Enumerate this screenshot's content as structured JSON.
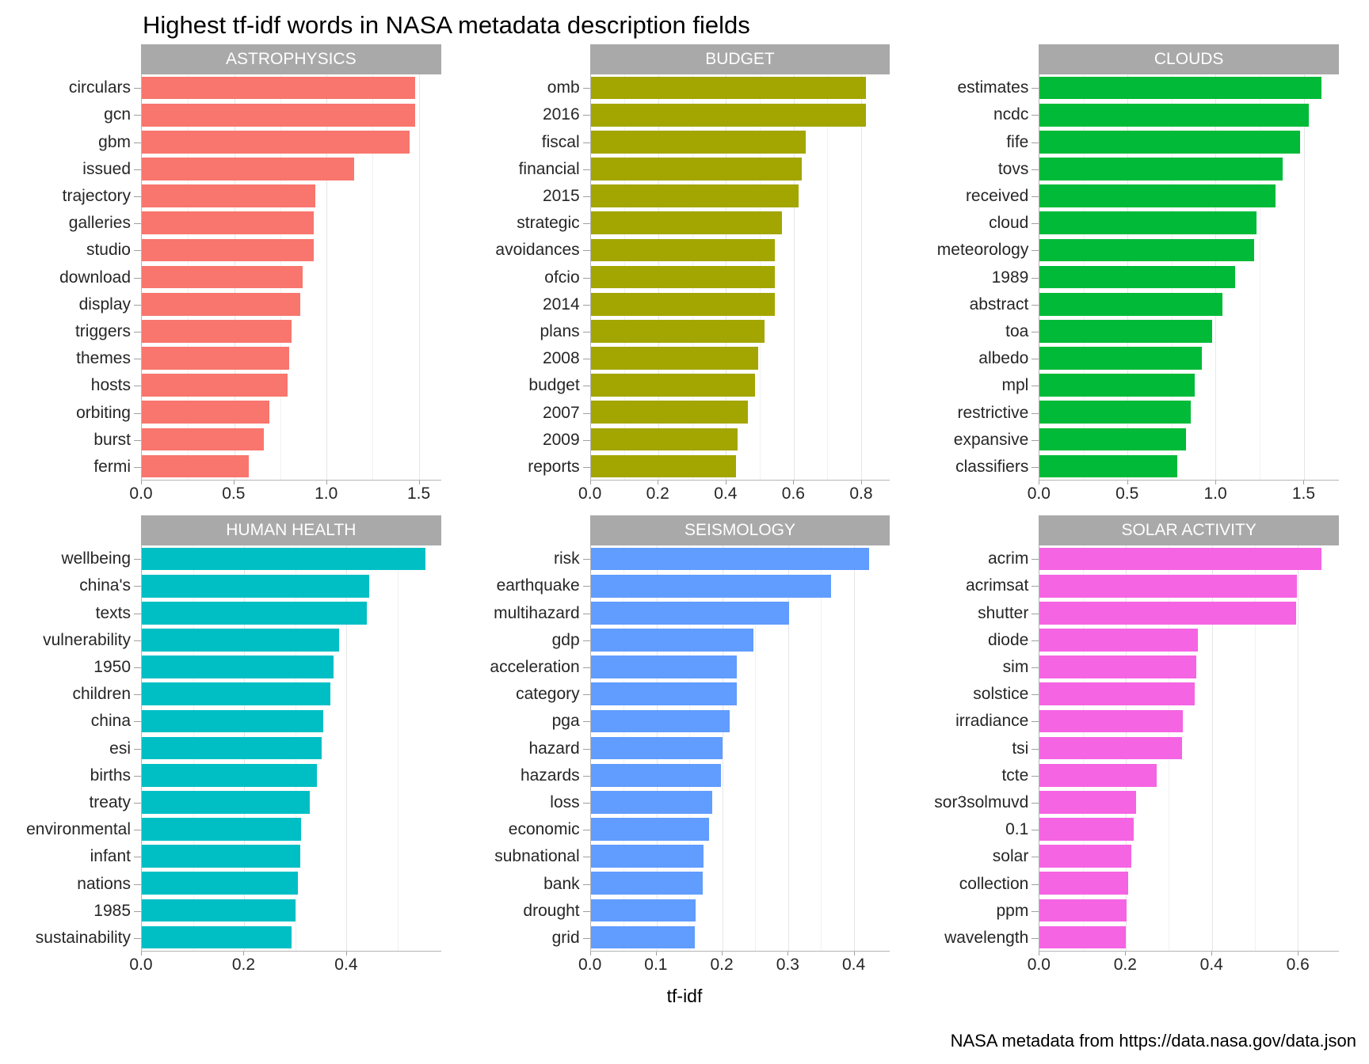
{
  "title": "Highest tf-idf words in NASA metadata description fields",
  "xaxis_title": "tf-idf",
  "caption": "NASA metadata from https://data.nasa.gov/data.json",
  "chart_data": {
    "type": "bar",
    "orientation": "horizontal",
    "title": "Highest tf-idf words in NASA metadata description fields",
    "xlabel": "tf-idf",
    "ylabel": "",
    "caption": "NASA metadata from https://data.nasa.gov/data.json",
    "grid": true,
    "legend": "none",
    "facets": [
      {
        "name": "ASTROPHYSICS",
        "color": "#f8766d",
        "xlim": [
          0,
          1.62
        ],
        "ticks": [
          0.0,
          0.5,
          1.0,
          1.5
        ],
        "tick_labels": [
          "0.0",
          "0.5",
          "1.0",
          "1.5"
        ],
        "minor_ticks": [
          0.25,
          0.75,
          1.25
        ],
        "categories": [
          "circulars",
          "gcn",
          "gbm",
          "issued",
          "trajectory",
          "galleries",
          "studio",
          "download",
          "display",
          "triggers",
          "themes",
          "hosts",
          "orbiting",
          "burst",
          "fermi"
        ],
        "values": [
          1.48,
          1.48,
          1.45,
          1.15,
          0.94,
          0.93,
          0.93,
          0.87,
          0.86,
          0.81,
          0.8,
          0.79,
          0.69,
          0.66,
          0.58
        ]
      },
      {
        "name": "BUDGET",
        "color": "#a3a500",
        "xlim": [
          0,
          0.885
        ],
        "ticks": [
          0.0,
          0.2,
          0.4,
          0.6,
          0.8
        ],
        "tick_labels": [
          "0.0",
          "0.2",
          "0.4",
          "0.6",
          "0.8"
        ],
        "minor_ticks": [
          0.1,
          0.3,
          0.5,
          0.7
        ],
        "categories": [
          "omb",
          "2016",
          "fiscal",
          "financial",
          "2015",
          "strategic",
          "avoidances",
          "ofcio",
          "2014",
          "plans",
          "2008",
          "budget",
          "2007",
          "2009",
          "reports"
        ],
        "values": [
          0.815,
          0.815,
          0.635,
          0.625,
          0.615,
          0.565,
          0.545,
          0.545,
          0.545,
          0.515,
          0.495,
          0.485,
          0.465,
          0.435,
          0.43
        ]
      },
      {
        "name": "CLOUDS",
        "color": "#00ba38",
        "xlim": [
          0,
          1.7
        ],
        "ticks": [
          0.0,
          0.5,
          1.0,
          1.5
        ],
        "tick_labels": [
          "0.0",
          "0.5",
          "1.0",
          "1.5"
        ],
        "minor_ticks": [
          0.25,
          0.75,
          1.25
        ],
        "categories": [
          "estimates",
          "ncdc",
          "fife",
          "tovs",
          "received",
          "cloud",
          "meteorology",
          "1989",
          "abstract",
          "toa",
          "albedo",
          "mpl",
          "restrictive",
          "expansive",
          "classifiers"
        ],
        "values": [
          1.6,
          1.53,
          1.48,
          1.38,
          1.34,
          1.23,
          1.22,
          1.11,
          1.04,
          0.98,
          0.92,
          0.88,
          0.86,
          0.83,
          0.78
        ]
      },
      {
        "name": "HUMAN HEALTH",
        "color": "#00bfc4",
        "xlim": [
          0,
          0.585
        ],
        "ticks": [
          0.0,
          0.2,
          0.4
        ],
        "tick_labels": [
          "0.0",
          "0.2",
          "0.4"
        ],
        "minor_ticks": [
          0.1,
          0.3,
          0.5
        ],
        "categories": [
          "wellbeing",
          "china's",
          "texts",
          "vulnerability",
          "1950",
          "children",
          "china",
          "esi",
          "births",
          "treaty",
          "environmental",
          "infant",
          "nations",
          "1985",
          "sustainability"
        ],
        "values": [
          0.555,
          0.445,
          0.44,
          0.385,
          0.375,
          0.368,
          0.355,
          0.352,
          0.343,
          0.328,
          0.312,
          0.31,
          0.305,
          0.3,
          0.293
        ]
      },
      {
        "name": "SEISMOLOGY",
        "color": "#619cff",
        "xlim": [
          0,
          0.455
        ],
        "ticks": [
          0.0,
          0.1,
          0.2,
          0.3,
          0.4
        ],
        "tick_labels": [
          "0.0",
          "0.1",
          "0.2",
          "0.3",
          "0.4"
        ],
        "minor_ticks": [
          0.05,
          0.15,
          0.25,
          0.35
        ],
        "categories": [
          "risk",
          "earthquake",
          "multihazard",
          "gdp",
          "acceleration",
          "category",
          "pga",
          "hazard",
          "hazards",
          "loss",
          "economic",
          "subnational",
          "bank",
          "drought",
          "grid"
        ],
        "values": [
          0.423,
          0.365,
          0.302,
          0.247,
          0.222,
          0.222,
          0.211,
          0.2,
          0.198,
          0.185,
          0.18,
          0.172,
          0.17,
          0.16,
          0.158
        ]
      },
      {
        "name": "SOLAR ACTIVITY",
        "color": "#f564e3",
        "xlim": [
          0,
          0.695
        ],
        "ticks": [
          0.0,
          0.2,
          0.4,
          0.6
        ],
        "tick_labels": [
          "0.0",
          "0.2",
          "0.4",
          "0.6"
        ],
        "minor_ticks": [
          0.1,
          0.3,
          0.5
        ],
        "categories": [
          "acrim",
          "acrimsat",
          "shutter",
          "diode",
          "sim",
          "solstice",
          "irradiance",
          "tsi",
          "tcte",
          "sor3solmuvd",
          "0.1",
          "solar",
          "collection",
          "ppm",
          "wavelength"
        ],
        "values": [
          0.655,
          0.598,
          0.595,
          0.368,
          0.363,
          0.36,
          0.332,
          0.33,
          0.272,
          0.224,
          0.218,
          0.212,
          0.205,
          0.201,
          0.2
        ]
      }
    ]
  }
}
